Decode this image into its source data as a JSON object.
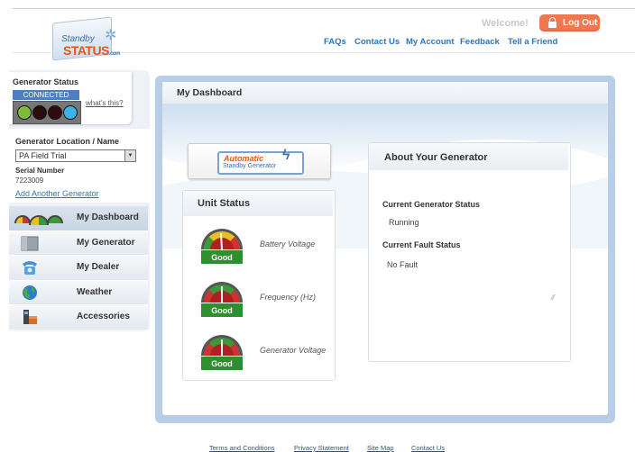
{
  "header": {
    "logo_line1": "Standby",
    "logo_line2": "STATUS",
    "logo_suffix": ".com",
    "welcome": "Welcome!",
    "logout_label": "Log Out",
    "nav": [
      "FAQs",
      "Contact Us",
      "My Account",
      "Feedback",
      "Tell a Friend"
    ]
  },
  "sidebar": {
    "status_label": "Generator Status",
    "connected_label": "CONNECTED",
    "whats_this": "what's this?",
    "lights": [
      {
        "name": "green-light",
        "color": "#7dbb3a"
      },
      {
        "name": "red-light-1",
        "color": "#2a0d0d"
      },
      {
        "name": "red-light-2",
        "color": "#300c12"
      },
      {
        "name": "blue-light",
        "color": "#3fb0e8"
      }
    ],
    "location_label": "Generator Location / Name",
    "location_value": "PA Field Trial",
    "serial_label": "Serial Number",
    "serial_value": "7223009",
    "add_generator": "Add Another Generator",
    "menu": [
      {
        "label": "My Dashboard",
        "icon": "dashboard-gauges-icon",
        "active": true
      },
      {
        "label": "My Generator",
        "icon": "generator-icon",
        "active": false
      },
      {
        "label": "My Dealer",
        "icon": "telephone-icon",
        "active": false
      },
      {
        "label": "Weather",
        "icon": "globe-icon",
        "active": false
      },
      {
        "label": "Accessories",
        "icon": "accessories-icon",
        "active": false
      }
    ]
  },
  "main": {
    "title": "My Dashboard",
    "auto_logo_line1": "Automatic",
    "auto_logo_line2": "Standby Generator",
    "unit_status": {
      "title": "Unit Status",
      "gauges": [
        {
          "label": "Battery Voltage",
          "status": "Good"
        },
        {
          "label": "Frequency (Hz)",
          "status": "Good"
        },
        {
          "label": "Generator Voltage",
          "status": "Good"
        }
      ]
    },
    "about": {
      "title": "About Your Generator",
      "current_status_label": "Current Generator Status",
      "current_status_value": "Running",
      "fault_label": "Current Fault Status",
      "fault_value": "No Fault"
    }
  },
  "footer": {
    "links": [
      "Terms and Conditions",
      "Privacy Statement",
      "Site Map",
      "Contact Us"
    ]
  },
  "colors": {
    "accent": "#2f76b3",
    "logout": "#f07850",
    "panel_border": "#b7cee6",
    "good": "#2f8f2f"
  }
}
